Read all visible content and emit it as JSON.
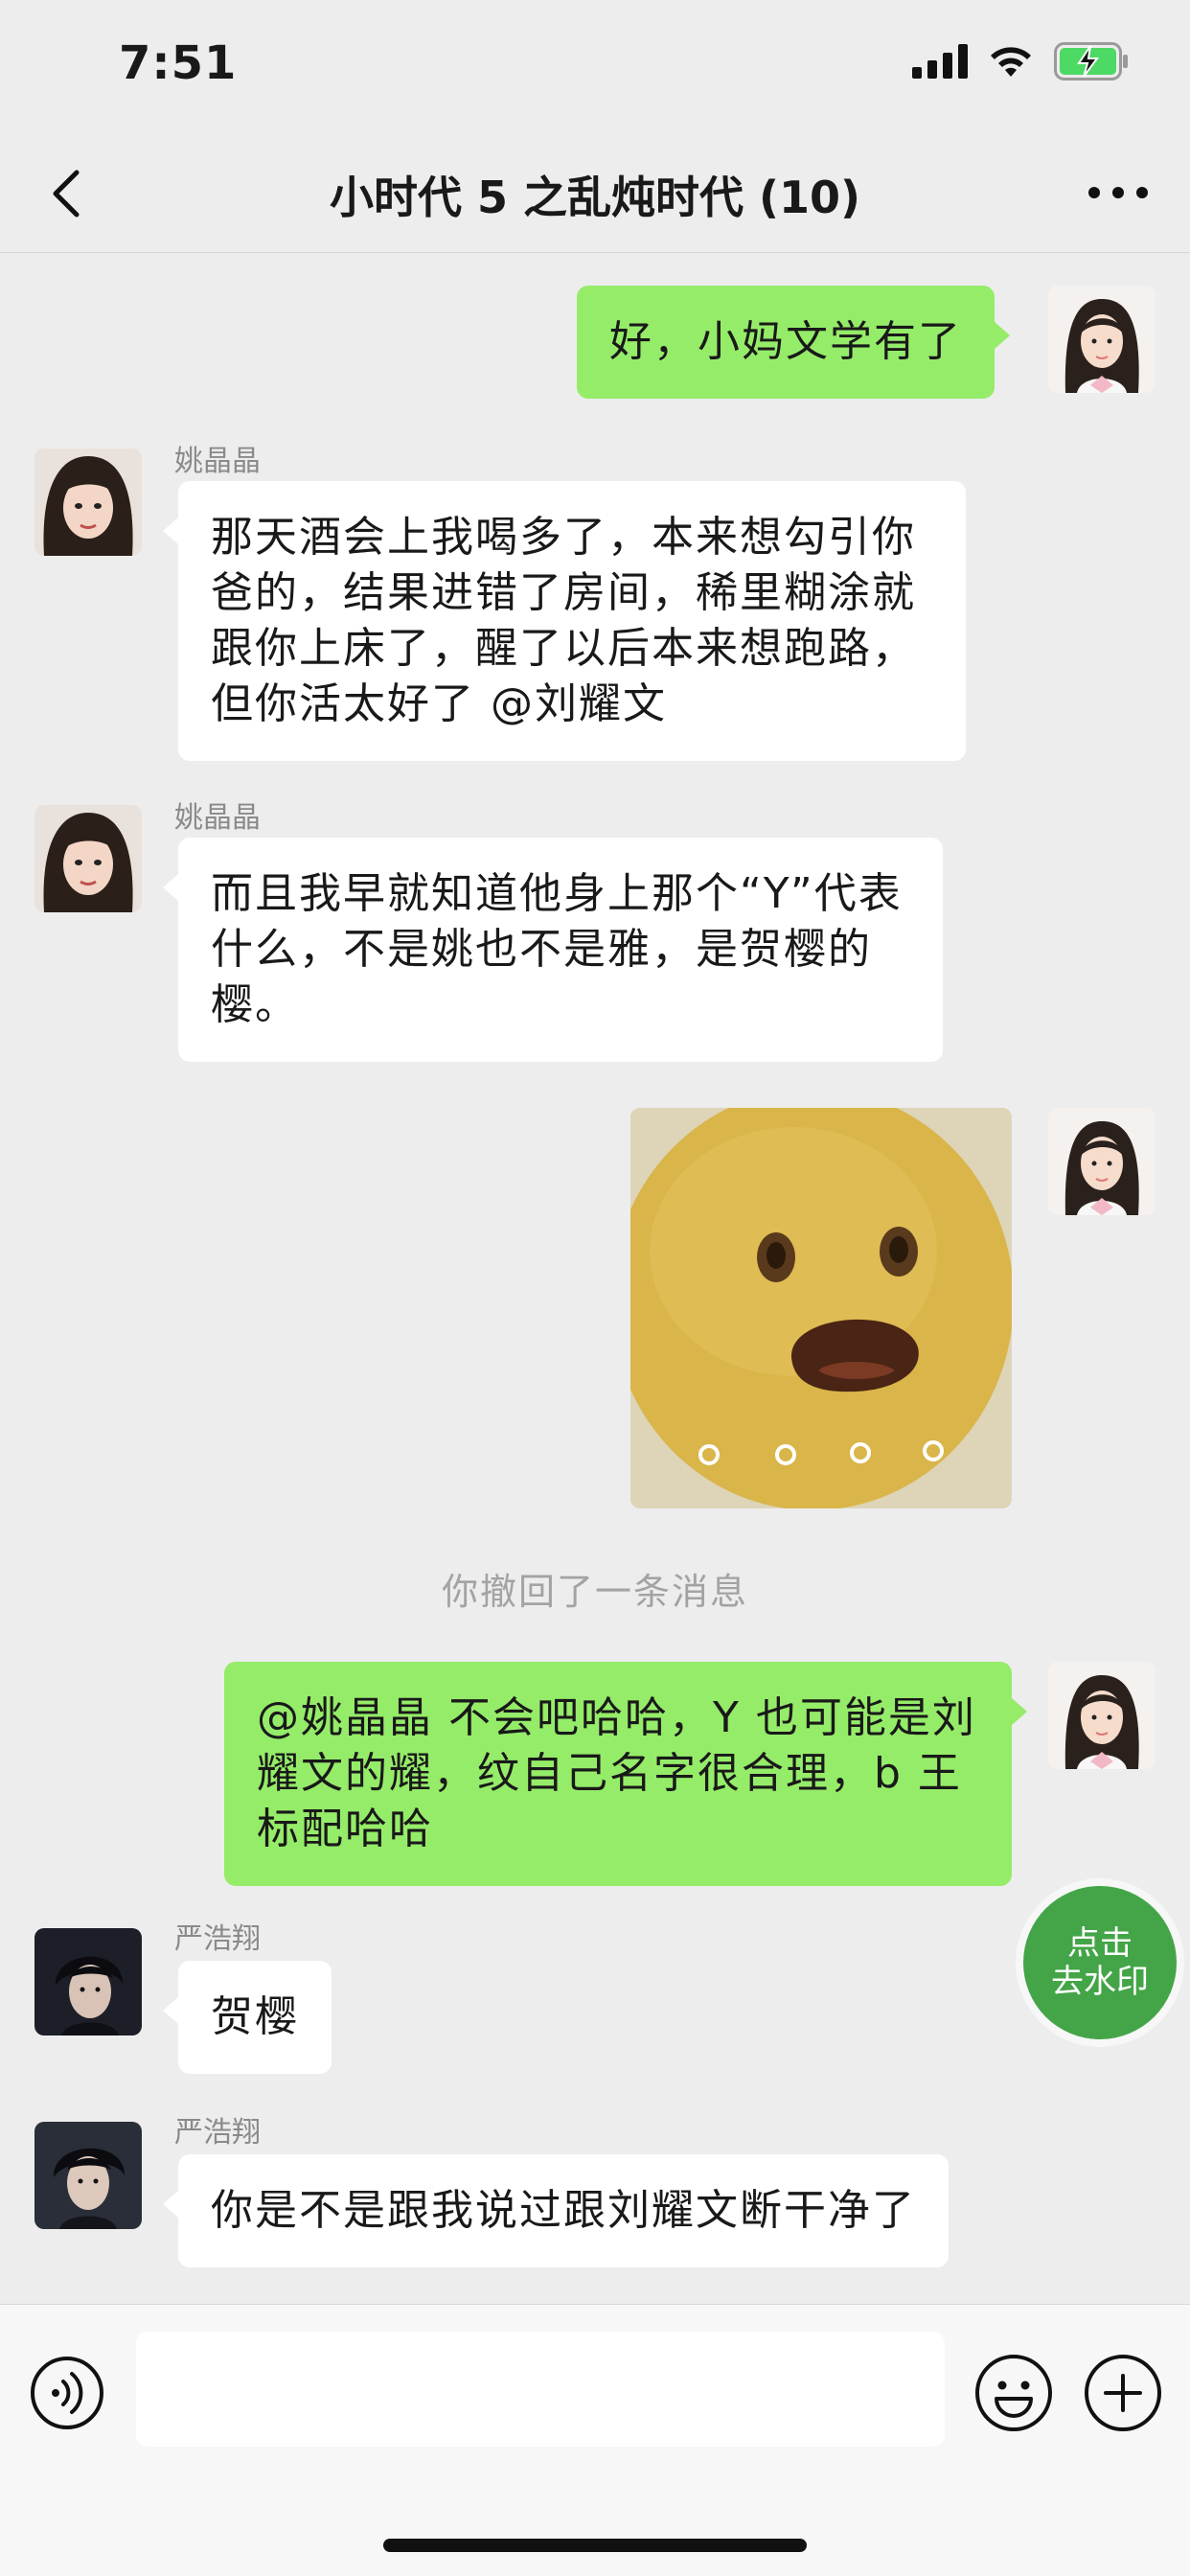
{
  "status_bar": {
    "time": "7:51",
    "icons": [
      "signal-icon",
      "wifi-icon",
      "battery-charging-icon"
    ],
    "battery_color": "#4cd964"
  },
  "nav": {
    "title": "小时代 5 之乱炖时代 (10)",
    "back_icon": "chevron-left-icon",
    "more_icon": "more-icon"
  },
  "messages": [
    {
      "side": "out",
      "type": "text",
      "text": "好，小妈文学有了"
    },
    {
      "side": "in",
      "sender": "姚晶晶",
      "type": "text",
      "text": "那天酒会上我喝多了，本来想勾引你\n爸的，结果进错了房间，稀里糊涂就\n跟你上床了，醒了以后本来想跑路，\n但你活太好了 @刘耀文"
    },
    {
      "side": "in",
      "sender": "姚晶晶",
      "type": "text",
      "text": "而且我早就知道他身上那个“Y”代表\n什么，不是姚也不是雅，是贺樱的\n樱。"
    },
    {
      "side": "out",
      "type": "sticker",
      "sticker": "shocked-lemon-sticker"
    },
    {
      "type": "system",
      "text": "你撤回了一条消息"
    },
    {
      "side": "out",
      "type": "text",
      "text": "@姚晶晶 不会吧哈哈，Y 也可能是刘\n耀文的耀，纹自己名字很合理，b 王\n标配哈哈"
    },
    {
      "side": "in",
      "sender": "严浩翔",
      "type": "text",
      "text": "贺樱"
    },
    {
      "side": "in",
      "sender": "严浩翔",
      "type": "text",
      "text": "你是不是跟我说过跟刘耀文断干净了"
    }
  ],
  "watermark_button": {
    "label": "点击\n去水印"
  },
  "input_bar": {
    "voice_icon": "voice-icon",
    "input_value": "",
    "emoji_icon": "emoji-icon",
    "plus_icon": "plus-icon"
  },
  "colors": {
    "background": "#ededed",
    "bubble_out": "#95ec69",
    "bubble_in": "#ffffff",
    "watermark_button": "#43a547"
  }
}
